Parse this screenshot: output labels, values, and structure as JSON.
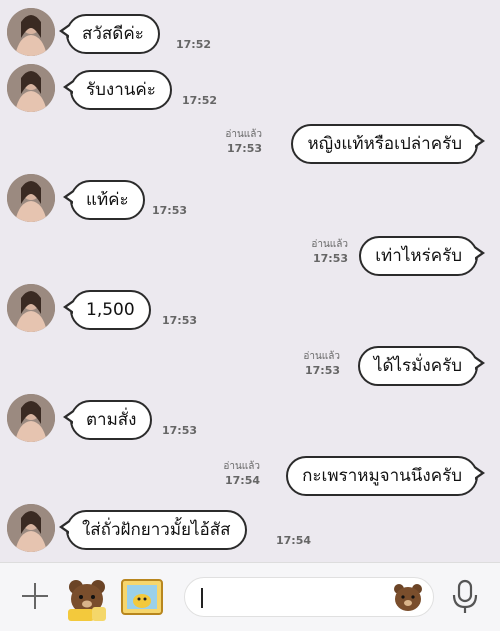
{
  "messages": [
    {
      "dir": "in",
      "text": "สวัสดีค่ะ",
      "time": "17:52"
    },
    {
      "dir": "in",
      "text": "รับงานค่ะ",
      "time": "17:52"
    },
    {
      "dir": "out",
      "text": "หญิงแท้หรือเปล่าครับ",
      "read": "อ่านแล้ว",
      "time": "17:53"
    },
    {
      "dir": "in",
      "text": "แท้ค่ะ",
      "time": "17:53"
    },
    {
      "dir": "out",
      "text": "เท่าไหร่ครับ",
      "read": "อ่านแล้ว",
      "time": "17:53"
    },
    {
      "dir": "in",
      "text": "1,500",
      "time": "17:53"
    },
    {
      "dir": "out",
      "text": "ได้ไรมั่งครับ",
      "read": "อ่านแล้ว",
      "time": "17:53"
    },
    {
      "dir": "in",
      "text": "ตามสั่ง",
      "time": "17:53"
    },
    {
      "dir": "out",
      "text": "กะเพราหมูจานนึงครับ",
      "read": "อ่านแล้ว",
      "time": "17:54"
    },
    {
      "dir": "in",
      "text": "ใส่ถั่วฝักยาวมั้ยไอ้สัส",
      "time": "17:54"
    }
  ],
  "composer": {
    "plus_icon": "plus-icon",
    "sticker_icon": "bear-sticker-icon",
    "image_icon": "image-icon",
    "emoji_icon": "bear-emoji-icon",
    "mic_icon": "microphone-icon"
  },
  "colors": {
    "background": "#ECE9EF",
    "bubble": "#FFFFFF",
    "bubble_border": "#2b2b2b",
    "composer_bg": "#F6F6F8"
  }
}
